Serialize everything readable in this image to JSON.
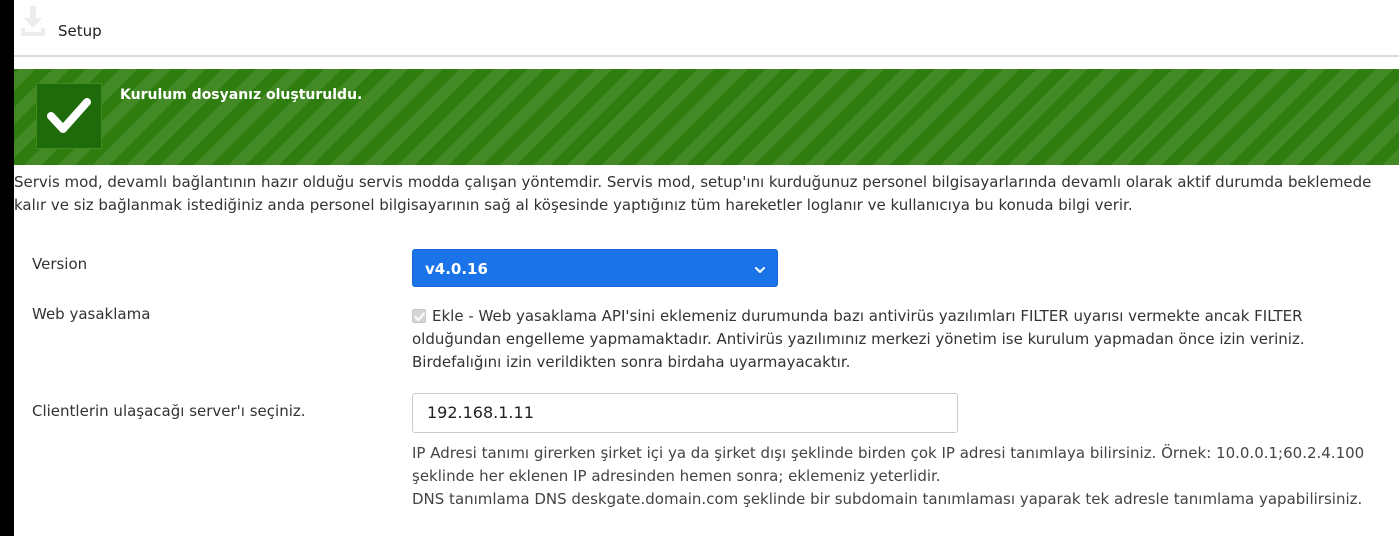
{
  "titlebar": {
    "title": "Setup",
    "icon": "download-icon"
  },
  "alert": {
    "message": "Kurulum dosyanız oluşturuldu.",
    "icon": "check-icon",
    "color": "#2e7d0e"
  },
  "description": "Servis mod, devamlı bağlantının hazır olduğu servis modda çalışan yöntemdir. Servis mod, setup'ını kurduğunuz personel bilgisayarlarında devamlı olarak aktif durumda beklemede kalır ve siz bağlanmak istediğiniz anda personel bilgisayarının sağ al köşesinde yaptığınız tüm hareketler loglanır ve kullanıcıya bu konuda bilgi verir.",
  "version": {
    "label": "Version",
    "selected": "v4.0.16",
    "accent": "#1a73e8"
  },
  "web": {
    "label": "Web yasaklama",
    "checked": true,
    "text": "Ekle - Web yasaklama API'sini eklemeniz durumunda bazı antivirüs yazılımları FILTER uyarısı vermekte ancak FILTER olduğundan engelleme yapmamaktadır. Antivirüs yazılımınız merkezi yönetim ise kurulum yapmadan önce izin veriniz. Birdefalığını izin verildikten sonra birdaha uyarmayacaktır."
  },
  "server": {
    "label": "Clientlerin ulaşacağı server'ı seçiniz.",
    "value": "192.168.1.11",
    "help1": "IP Adresi tanımı girerken şirket içi ya da şirket dışı şeklinde birden çok IP adresi tanımlaya bilirsiniz. Örnek: 10.0.0.1;60.2.4.100 şeklinde her eklenen IP adresinden hemen sonra; eklemeniz yeterlidir.",
    "help2": "DNS tanımlama DNS deskgate.domain.com şeklinde bir subdomain tanımlaması yaparak tek adresle tanımlama yapabilirsiniz."
  }
}
